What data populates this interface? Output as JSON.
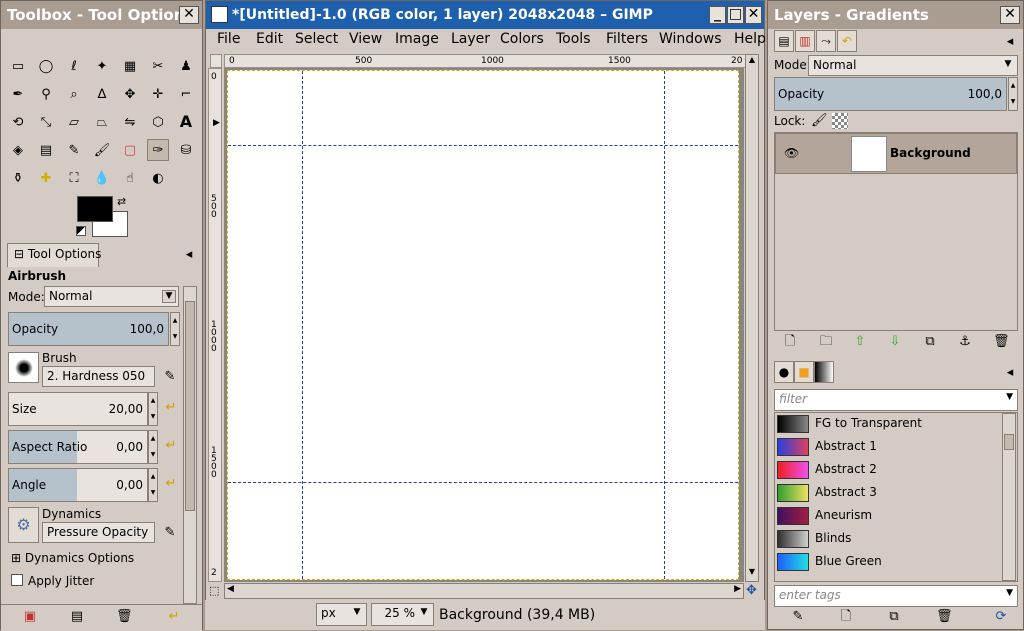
{
  "toolbox": {
    "title": "Toolbox - Tool Options",
    "tab_label": "Tool Options",
    "tool_name": "Airbrush",
    "mode_label": "Mode:",
    "mode_value": "Normal",
    "opacity_label": "Opacity",
    "opacity_value": "100,0",
    "opacity_fraction": 1.0,
    "brush_label": "Brush",
    "brush_value": "2. Hardness 050",
    "size_label": "Size",
    "size_value": "20,00",
    "aspect_label": "Aspect Ratio",
    "aspect_value": "0,00",
    "angle_label": "Angle",
    "angle_value": "0,00",
    "dynamics_label": "Dynamics",
    "dynamics_value": "Pressure Opacity",
    "dynamics_options_label": "Dynamics Options",
    "apply_jitter_label": "Apply Jitter",
    "fg_color": "#000000",
    "bg_color": "#ffffff"
  },
  "image_window": {
    "title": "*[Untitled]-1.0 (RGB color, 1 layer) 2048x2048 – GIMP",
    "menu": [
      "File",
      "Edit",
      "Select",
      "View",
      "Image",
      "Layer",
      "Colors",
      "Tools",
      "Filters",
      "Windows",
      "Help"
    ],
    "ruler_h": [
      "0",
      "500",
      "1000",
      "1500",
      "20"
    ],
    "ruler_v": [
      "0",
      "500",
      "1000",
      "1500",
      "2"
    ],
    "unit": "px",
    "zoom": "25 %",
    "status": "Background (39,4 MB)"
  },
  "layers": {
    "title": "Layers - Gradients",
    "mode_label": "Mode:",
    "mode_value": "Normal",
    "opacity_label": "Opacity",
    "opacity_value": "100,0",
    "lock_label": "Lock:",
    "layer_name": "Background"
  },
  "gradients": {
    "filter_placeholder": "filter",
    "tags_placeholder": "enter tags",
    "items": [
      {
        "name": "FG to Transparent",
        "colors": [
          "#000000",
          "#888888"
        ]
      },
      {
        "name": "Abstract 1",
        "colors": [
          "#2840e0",
          "#e04060"
        ]
      },
      {
        "name": "Abstract 2",
        "colors": [
          "#f02020",
          "#f050f0"
        ]
      },
      {
        "name": "Abstract 3",
        "colors": [
          "#30a030",
          "#f0e060"
        ]
      },
      {
        "name": "Aneurism",
        "colors": [
          "#401060",
          "#a02040"
        ]
      },
      {
        "name": "Blinds",
        "colors": [
          "#303030",
          "#d0d0d0"
        ]
      },
      {
        "name": "Blue Green",
        "colors": [
          "#2060ff",
          "#20e0e0"
        ]
      }
    ]
  }
}
